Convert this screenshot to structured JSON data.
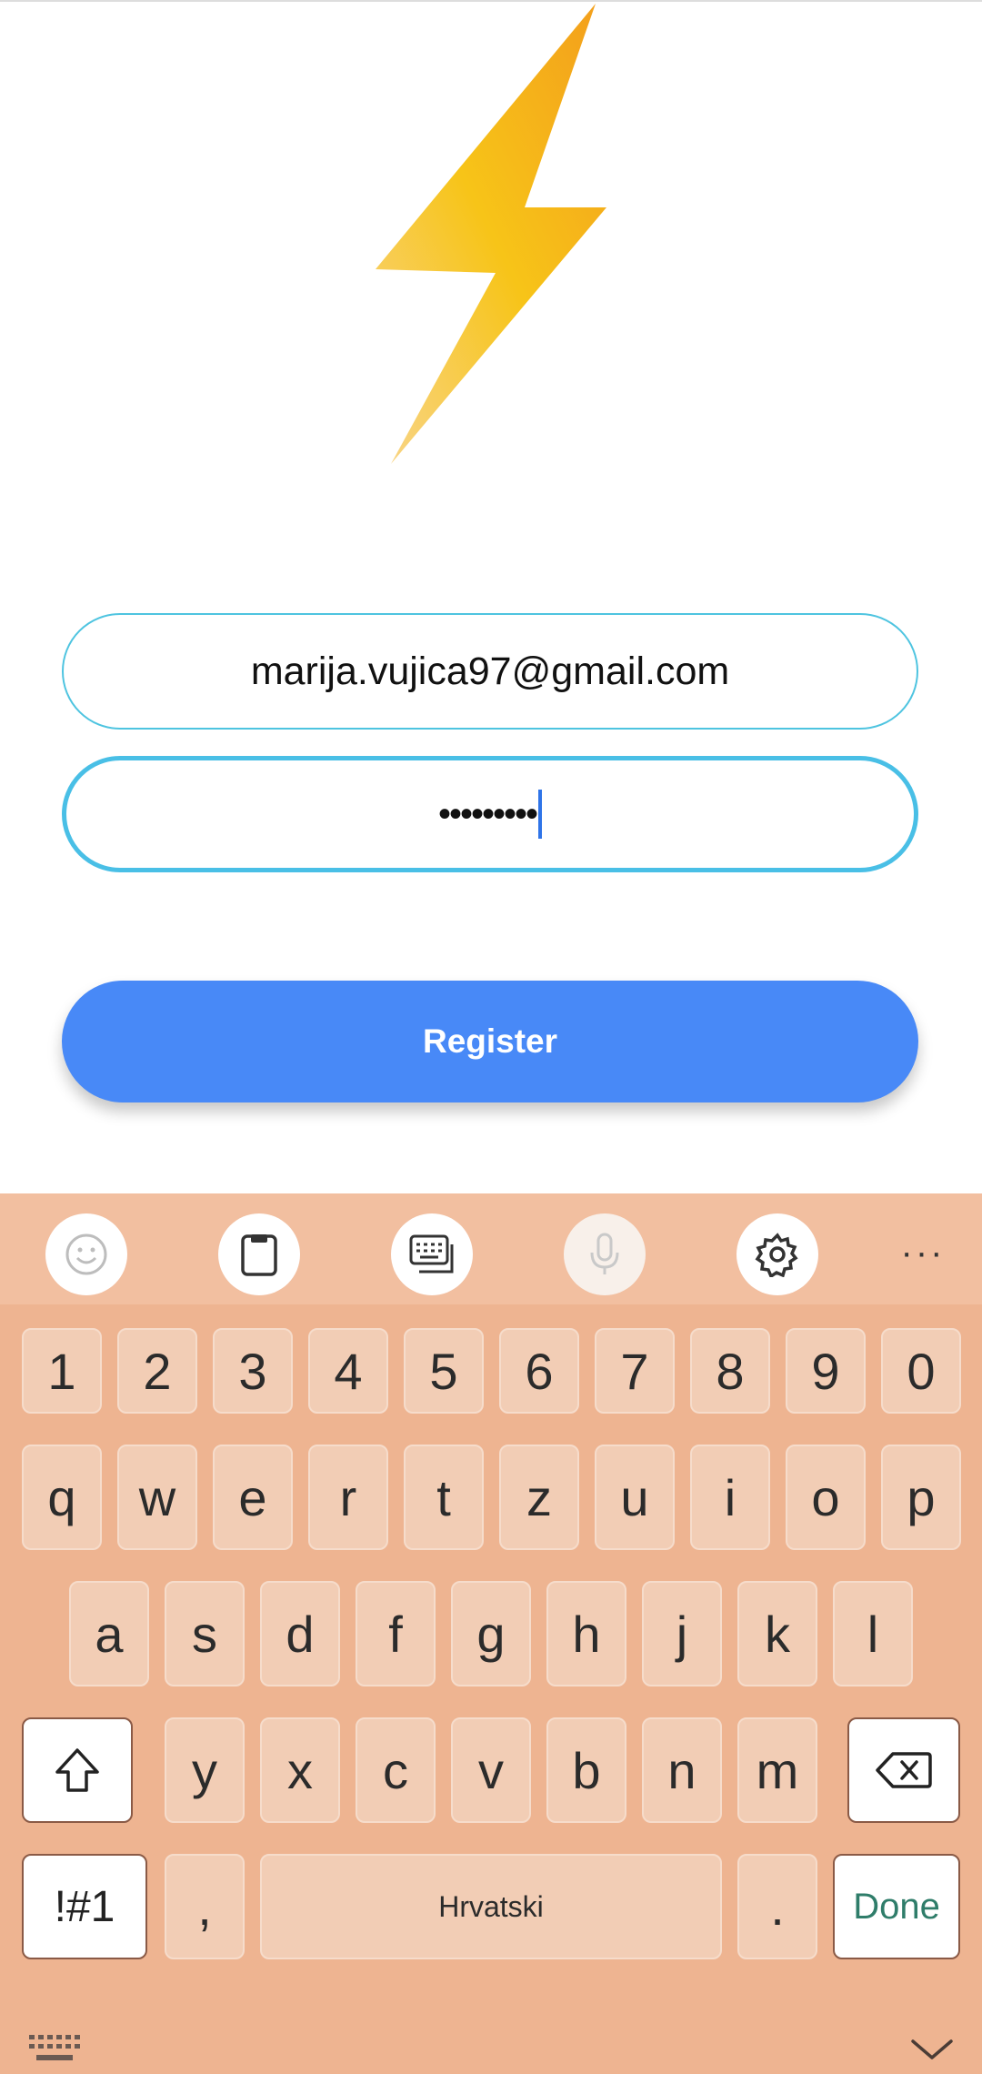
{
  "login": {
    "email_value": "marija.vujica97@gmail.com",
    "password_value": "•••••••••",
    "register_label": "Register"
  },
  "keyboard": {
    "toolbar_icons": [
      "emoji-icon",
      "clipboard-icon",
      "keyboard-layout-icon",
      "microphone-icon",
      "settings-icon",
      "more-icon"
    ],
    "more_label": "···",
    "row_numbers": [
      "1",
      "2",
      "3",
      "4",
      "5",
      "6",
      "7",
      "8",
      "9",
      "0"
    ],
    "row_q": [
      "q",
      "w",
      "e",
      "r",
      "t",
      "z",
      "u",
      "i",
      "o",
      "p"
    ],
    "row_a": [
      "a",
      "s",
      "d",
      "f",
      "g",
      "h",
      "j",
      "k",
      "l"
    ],
    "row_z": [
      "y",
      "x",
      "c",
      "v",
      "b",
      "n",
      "m"
    ],
    "symbols_label": "!#1",
    "comma_label": ",",
    "space_label": "Hrvatski",
    "period_label": ".",
    "done_label": "Done"
  },
  "colors": {
    "accent_blue": "#4889f7",
    "field_border": "#4ec4e0",
    "keyboard_bg": "#eeb491",
    "bolt_orange": "#f3a21b",
    "bolt_yellow": "#f7c516"
  }
}
